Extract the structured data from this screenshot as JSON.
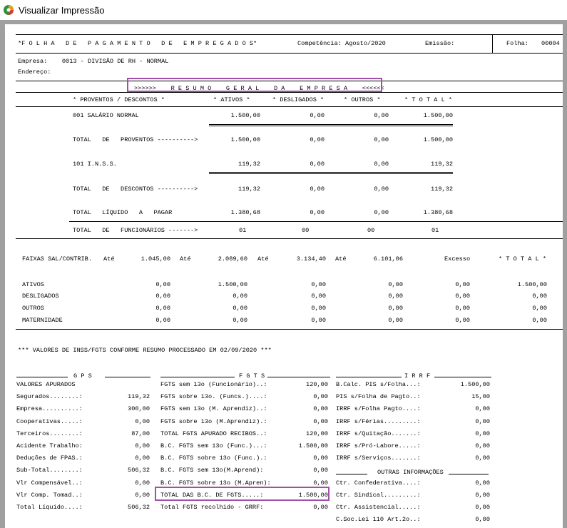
{
  "window": {
    "title": "Visualizar Impressão"
  },
  "header": {
    "report_title": "*F O L H A   D E   P A G A M E N T O   D E   E M P R E G A D O S*",
    "competencia": "Competência: Agosto/2020",
    "emissao": "Emissão:",
    "folha_label": "Folha:",
    "folha_value": "00004",
    "empresa": "Empresa:    0013 - DIVISÃO DE RH - NORMAL",
    "endereco": "Endereço:"
  },
  "resumo": {
    "title": ">>>>>>    R E S U M O    G E R A L    D A    E M P R E S A    <<<<<<",
    "col_proventos": "* PROVENTOS / DESCONTOS *",
    "col_ativos": "* ATIVOS *",
    "col_desligados": "* DESLIGADOS *",
    "col_outros": "* OUTROS *",
    "col_total": "* T O T A L *",
    "rows": [
      {
        "label": "001 SALÁRIO NORMAL",
        "ativos": "1.500,00",
        "desligados": "0,00",
        "outros": "0,00",
        "total": "1.500,00"
      },
      {
        "label": "TOTAL   DE   PROVENTOS ---------->",
        "ativos": "1.500,00",
        "desligados": "0,00",
        "outros": "0,00",
        "total": "1.500,00"
      },
      {
        "label": "101 I.N.S.S.",
        "ativos": "119,32",
        "desligados": "0,00",
        "outros": "0,00",
        "total": "119,32"
      },
      {
        "label": "TOTAL   DE   DESCONTOS ---------->",
        "ativos": "119,32",
        "desligados": "0,00",
        "outros": "0,00",
        "total": "119,32"
      },
      {
        "label": "TOTAL   LÍQUIDO   A   PAGAR",
        "ativos": "1.380,68",
        "desligados": "0,00",
        "outros": "0,00",
        "total": "1.380,68"
      },
      {
        "label": "TOTAL   DE   FUNCIONÁRIOS ------->",
        "ativos": "01",
        "desligados": "00",
        "outros": "00",
        "total": "01"
      }
    ]
  },
  "faixas": {
    "header_label": "FAIXAS SAL/CONTRIB.",
    "ate": "Até",
    "limits": [
      "1.045,00",
      "2.089,60",
      "3.134,40",
      "6.101,06"
    ],
    "excesso": "Excesso",
    "total": "* T O T A L *",
    "rows": [
      {
        "label": "ATIVOS",
        "values": [
          "0,00",
          "1.500,00",
          "0,00",
          "0,00",
          "0,00",
          "1.500,00"
        ]
      },
      {
        "label": "DESLIGADOS",
        "values": [
          "0,00",
          "0,00",
          "0,00",
          "0,00",
          "0,00",
          "0,00"
        ]
      },
      {
        "label": "OUTROS",
        "values": [
          "0,00",
          "0,00",
          "0,00",
          "0,00",
          "0,00",
          "0,00"
        ]
      },
      {
        "label": "MATERNIDADE",
        "values": [
          "0,00",
          "0,00",
          "0,00",
          "0,00",
          "0,00",
          "0,00"
        ]
      }
    ]
  },
  "valores_title": "*** VALORES DE INSS/FGTS CONFORME RESUMO PROCESSADO EM 02/09/2020 ***",
  "gps": {
    "title": "G P S",
    "rows": [
      {
        "label": "VALORES APURADOS",
        "value": ""
      },
      {
        "label": "Segurados........:",
        "value": "119,32"
      },
      {
        "label": "Empresa..........:",
        "value": "300,00"
      },
      {
        "label": "Cooperativas.....:",
        "value": "0,00"
      },
      {
        "label": "Terceiros........:",
        "value": "87,00"
      },
      {
        "label": "Acidente Trabalho:",
        "value": "0,00"
      },
      {
        "label": "Deduções de FPAS.:",
        "value": "0,00"
      },
      {
        "label": "Sub-Total........:",
        "value": "506,32"
      },
      {
        "label": "Vlr Compensável..:",
        "value": "0,00"
      },
      {
        "label": "Vlr Comp. Tomad..:",
        "value": "0,00"
      },
      {
        "label": "Total Líquido....:",
        "value": "506,32"
      }
    ]
  },
  "fgts": {
    "title": "F G T S",
    "rows": [
      {
        "label": "FGTS sem 13o (Funcionário)..:",
        "value": "120,00"
      },
      {
        "label": "FGTS sobre 13o. (Funcs.)....:",
        "value": "0,00"
      },
      {
        "label": "FGTS sem 13o (M. Aprendiz)..:",
        "value": "0,00"
      },
      {
        "label": "FGTS sobre 13o (M.Aprendiz).:",
        "value": "0,00"
      },
      {
        "label": "TOTAL FGTS APURADO RECIBOS..:",
        "value": "120,00"
      },
      {
        "label": "B.C. FGTS sem 13o (Func.)...:",
        "value": "1.500,00"
      },
      {
        "label": "B.C. FGTS sobre 13o (Func.).:",
        "value": "0,00"
      },
      {
        "label": "B.C. FGTS sem 13o(M.Aprend):",
        "value": "0,00"
      },
      {
        "label": "B.C. FGTS sobre 13o (M.Apren):",
        "value": "0,00"
      },
      {
        "label": "TOTAL DAS B.C. DE FGTS.....:",
        "value": "1.500,00"
      },
      {
        "label": "Total FGTS recolhido - GRRF:",
        "value": "0,00"
      }
    ]
  },
  "irrf": {
    "title": "I R R F",
    "rows": [
      {
        "label": "B.Calc. PIS s/Folha...:",
        "value": "1.500,00"
      },
      {
        "label": "PIS s/Folha de Pagto..:",
        "value": "15,00"
      },
      {
        "label": "IRRF s/Folha Pagto....:",
        "value": "0,00"
      },
      {
        "label": "IRRF s/Férias.........:",
        "value": "0,00"
      },
      {
        "label": "IRRF s/Quitação.......:",
        "value": "0,00"
      },
      {
        "label": "IRRF s/Pró-Labore.....:",
        "value": "0,00"
      },
      {
        "label": "IRRF s/Serviços.......:",
        "value": "0,00"
      }
    ],
    "outras_title": "OUTRAS INFORMAÇÕES",
    "outras_rows": [
      {
        "label": "Ctr. Confederativa....:",
        "value": "0,00"
      },
      {
        "label": "Ctr. Sindical.........:",
        "value": "0,00"
      },
      {
        "label": "Ctr. Assistencial.....:",
        "value": "0,00"
      },
      {
        "label": "C.Soc.Lei 110 Art.2o..:",
        "value": "0,00"
      }
    ]
  },
  "colors": {
    "highlight": "#a050a8",
    "frame": "#a0a0a0"
  }
}
